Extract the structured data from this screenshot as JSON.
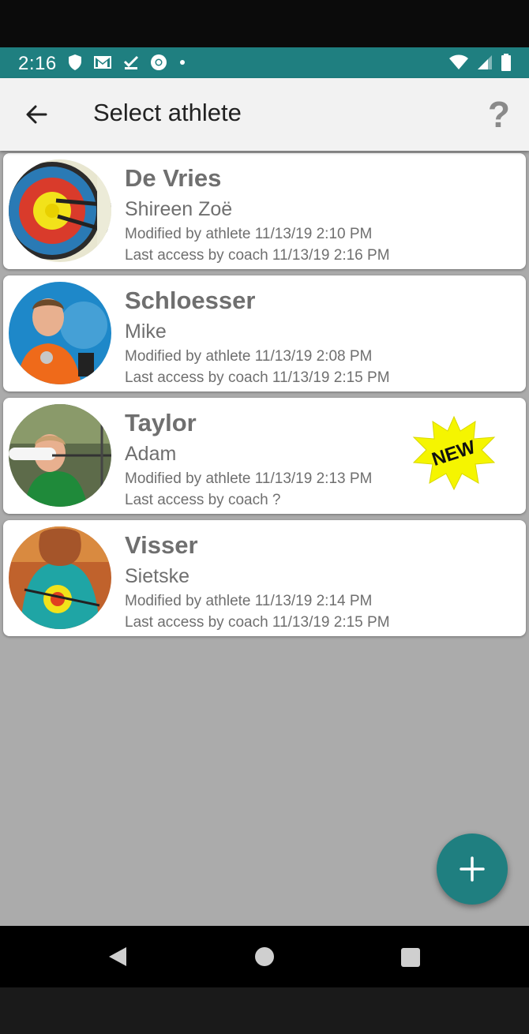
{
  "status_bar": {
    "time": "2:16",
    "left_icons": [
      "shield-icon",
      "gmail-icon",
      "check-icon",
      "chrome-icon",
      "dot-icon"
    ],
    "right_icons": [
      "wifi-icon",
      "signal-icon",
      "battery-icon"
    ],
    "color": "#1f7f80"
  },
  "app_bar": {
    "title": "Select athlete",
    "help_label": "?"
  },
  "athletes": [
    {
      "surname": "De Vries",
      "first_name": "Shireen Zoë",
      "modified": "Modified by athlete 11/13/19 2:10 PM",
      "last_access": "Last access by coach 11/13/19 2:16 PM",
      "avatar": "archery-target-avatar"
    },
    {
      "surname": "Schloesser",
      "first_name": "Mike",
      "modified": "Modified by athlete 11/13/19 2:08 PM",
      "last_access": "Last access by coach 11/13/19 2:15 PM",
      "avatar": "athlete-photo-avatar"
    },
    {
      "surname": "Taylor",
      "first_name": "Adam",
      "modified": "Modified by athlete 11/13/19 2:13 PM",
      "last_access": "Last access by coach ?",
      "avatar": "athlete-photo-avatar",
      "badge": "NEW"
    },
    {
      "surname": "Visser",
      "first_name": "Sietske",
      "modified": "Modified by athlete 11/13/19 2:14 PM",
      "last_access": "Last access by coach 11/13/19 2:15 PM",
      "avatar": "athlete-photo-avatar"
    }
  ],
  "fab": {
    "icon": "plus-icon"
  },
  "nav_bar": {
    "icons": [
      "nav-back-icon",
      "nav-home-icon",
      "nav-recents-icon"
    ]
  },
  "colors": {
    "accent": "#1f7f80",
    "background": "#ababab",
    "badge_yellow": "#f5f500"
  }
}
